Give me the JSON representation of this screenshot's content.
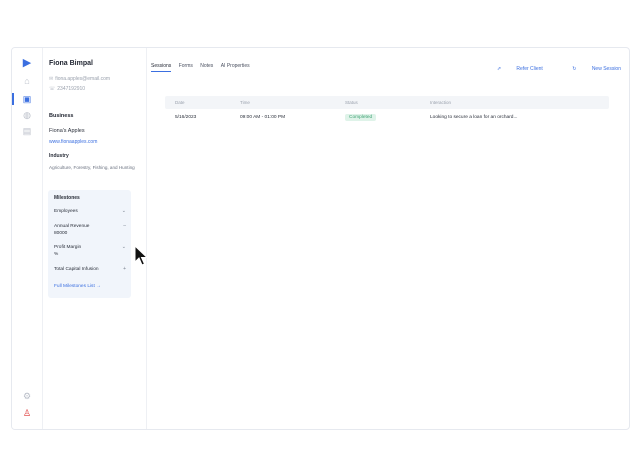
{
  "client": {
    "name": "Fiona Bimpal",
    "email": "fiona.apples@email.com",
    "phone": "2347192910"
  },
  "business": {
    "section_title": "Business",
    "name": "Fiona's Apples",
    "website": "www.fionaapples.com",
    "industry_title": "Industry",
    "industry_value": "Agriculture, Forestry, Fishing, and Hunting"
  },
  "milestones": {
    "title": "Milestones",
    "items": [
      {
        "label": "Employees",
        "value": ""
      },
      {
        "label": "Annual Revenue",
        "value": "80000"
      },
      {
        "label": "Profit Margin",
        "value": "%"
      },
      {
        "label": "Total Capital Infusion",
        "value": ""
      }
    ],
    "link": "Full Milestones List →"
  },
  "tabs": [
    "Sessions",
    "Forms",
    "Notes",
    "AI Properties"
  ],
  "actions": {
    "refer": "Refer Client",
    "new_session": "New Session"
  },
  "table": {
    "headers": [
      "Date",
      "Time",
      "Status",
      "Interaction"
    ],
    "rows": [
      {
        "date": "5/16/2023",
        "time": "09:00 AM - 01:00 PM",
        "status": "Completed",
        "note": "Looking to secure a loan for an orchard..."
      }
    ]
  },
  "colors": {
    "accent": "#3b6fe0",
    "status_green": "#3fa274"
  }
}
